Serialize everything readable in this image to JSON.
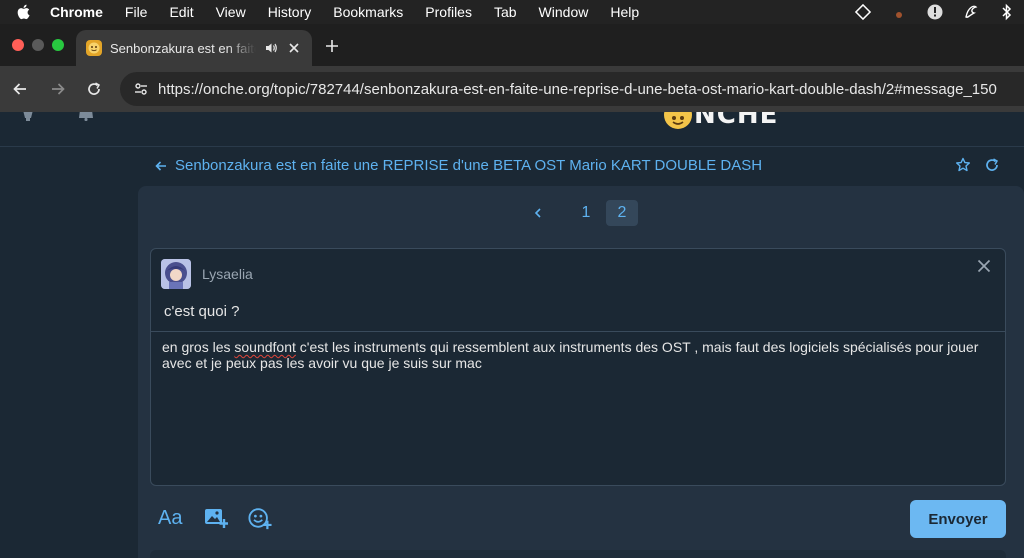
{
  "menubar": {
    "app": "Chrome",
    "items": [
      "File",
      "Edit",
      "View",
      "History",
      "Bookmarks",
      "Profiles",
      "Tab",
      "Window",
      "Help"
    ]
  },
  "browser": {
    "tab_title": "Senbonzakura est en faite une REPRISE d'une BETA OST Mario KART DOUBLE DASH",
    "url": "https://onche.org/topic/782744/senbonzakura-est-en-faite-une-reprise-d-une-beta-ost-mario-kart-double-dash/2#message_150"
  },
  "site": {
    "logo_text": "NCHE",
    "logo_full": "ONCHE"
  },
  "topic": {
    "title": "Senbonzakura est en faite une REPRISE d'une BETA OST Mario KART DOUBLE DASH"
  },
  "pagination": {
    "pages": [
      "1",
      "2"
    ],
    "current": "2"
  },
  "reply": {
    "quote_author": "Lysaelia",
    "quote_text": "c'est quoi ?",
    "message_before": "en gros les ",
    "message_misspelled": "soundfont",
    "message_after": " c'est les instruments qui ressemblent aux instruments des OST , mais faut des logiciels spécialisés pour jouer avec et je peux pas les avoir vu que je suis sur mac",
    "format_label": "Aa",
    "send_label": "Envoyer"
  },
  "colors": {
    "accent": "#5eb2f0",
    "button": "#6cb8f2",
    "background": "#1b2834",
    "panel": "#243241"
  }
}
